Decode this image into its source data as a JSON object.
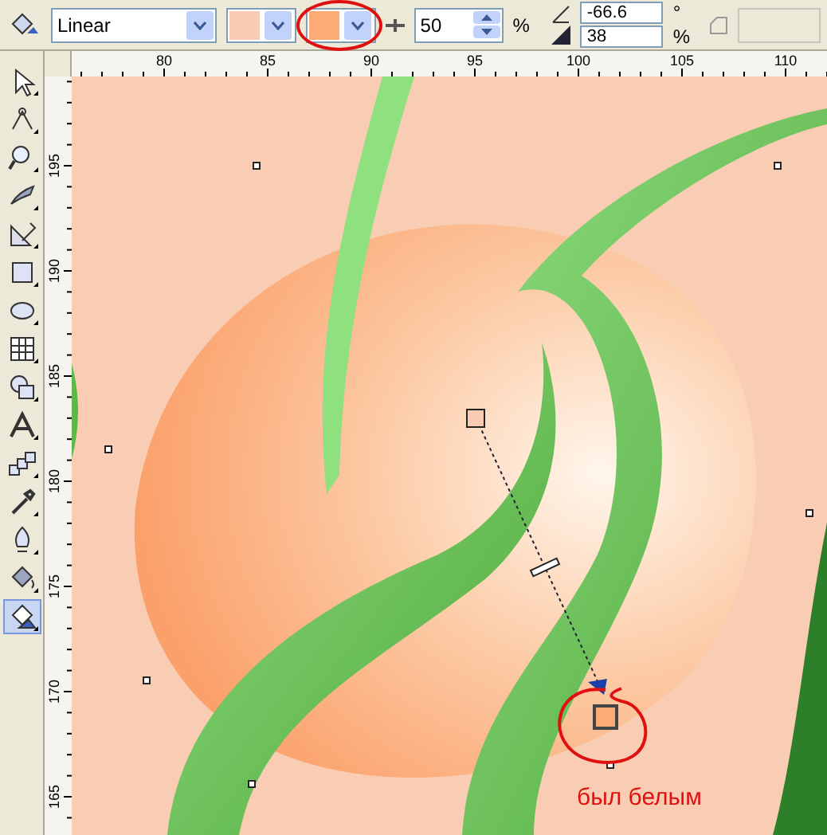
{
  "toolbar": {
    "fill_type": "Linear",
    "from_swatch": {
      "color": "#f9cbb0"
    },
    "to_swatch": {
      "color": "#fcab74",
      "circled": true
    },
    "midpoint": "50",
    "midpoint_unit": "%",
    "angle": "-66.6",
    "angle_unit": "°",
    "edge_pad": "38",
    "edge_pad_unit": "%"
  },
  "horizontal_ruler": [
    "80",
    "85",
    "90",
    "95",
    "100",
    "105",
    "110"
  ],
  "vertical_ruler": [
    "195",
    "190",
    "185",
    "180",
    "175",
    "170",
    "165"
  ],
  "tools": [
    {
      "kind": "pick",
      "selected": false
    },
    {
      "kind": "shape",
      "selected": false
    },
    {
      "kind": "zoom",
      "selected": false
    },
    {
      "kind": "freehand",
      "selected": false
    },
    {
      "kind": "dimension",
      "selected": false
    },
    {
      "kind": "rectangle",
      "selected": false
    },
    {
      "kind": "ellipse",
      "selected": false
    },
    {
      "kind": "table",
      "selected": false
    },
    {
      "kind": "shapes",
      "selected": false
    },
    {
      "kind": "text",
      "selected": false
    },
    {
      "kind": "blend",
      "selected": false
    },
    {
      "kind": "eyedropper",
      "selected": false
    },
    {
      "kind": "pen",
      "selected": false
    },
    {
      "kind": "bucket",
      "selected": false
    },
    {
      "kind": "interactive-fill",
      "selected": true
    }
  ],
  "annotation": "был белым"
}
